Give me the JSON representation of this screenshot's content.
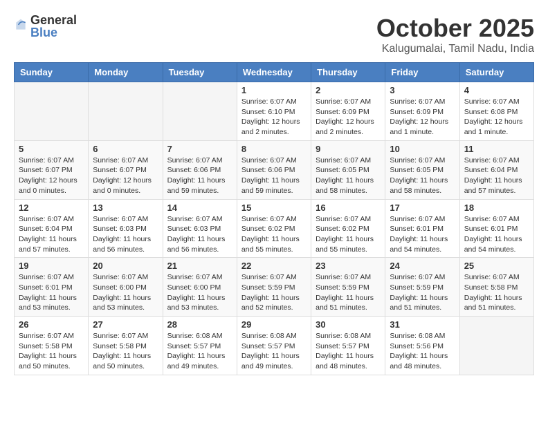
{
  "header": {
    "logo_general": "General",
    "logo_blue": "Blue",
    "month_title": "October 2025",
    "location": "Kalugumalai, Tamil Nadu, India"
  },
  "weekdays": [
    "Sunday",
    "Monday",
    "Tuesday",
    "Wednesday",
    "Thursday",
    "Friday",
    "Saturday"
  ],
  "weeks": [
    [
      {
        "day": "",
        "info": ""
      },
      {
        "day": "",
        "info": ""
      },
      {
        "day": "",
        "info": ""
      },
      {
        "day": "1",
        "info": "Sunrise: 6:07 AM\nSunset: 6:10 PM\nDaylight: 12 hours\nand 2 minutes."
      },
      {
        "day": "2",
        "info": "Sunrise: 6:07 AM\nSunset: 6:09 PM\nDaylight: 12 hours\nand 2 minutes."
      },
      {
        "day": "3",
        "info": "Sunrise: 6:07 AM\nSunset: 6:09 PM\nDaylight: 12 hours\nand 1 minute."
      },
      {
        "day": "4",
        "info": "Sunrise: 6:07 AM\nSunset: 6:08 PM\nDaylight: 12 hours\nand 1 minute."
      }
    ],
    [
      {
        "day": "5",
        "info": "Sunrise: 6:07 AM\nSunset: 6:07 PM\nDaylight: 12 hours\nand 0 minutes."
      },
      {
        "day": "6",
        "info": "Sunrise: 6:07 AM\nSunset: 6:07 PM\nDaylight: 12 hours\nand 0 minutes."
      },
      {
        "day": "7",
        "info": "Sunrise: 6:07 AM\nSunset: 6:06 PM\nDaylight: 11 hours\nand 59 minutes."
      },
      {
        "day": "8",
        "info": "Sunrise: 6:07 AM\nSunset: 6:06 PM\nDaylight: 11 hours\nand 59 minutes."
      },
      {
        "day": "9",
        "info": "Sunrise: 6:07 AM\nSunset: 6:05 PM\nDaylight: 11 hours\nand 58 minutes."
      },
      {
        "day": "10",
        "info": "Sunrise: 6:07 AM\nSunset: 6:05 PM\nDaylight: 11 hours\nand 58 minutes."
      },
      {
        "day": "11",
        "info": "Sunrise: 6:07 AM\nSunset: 6:04 PM\nDaylight: 11 hours\nand 57 minutes."
      }
    ],
    [
      {
        "day": "12",
        "info": "Sunrise: 6:07 AM\nSunset: 6:04 PM\nDaylight: 11 hours\nand 57 minutes."
      },
      {
        "day": "13",
        "info": "Sunrise: 6:07 AM\nSunset: 6:03 PM\nDaylight: 11 hours\nand 56 minutes."
      },
      {
        "day": "14",
        "info": "Sunrise: 6:07 AM\nSunset: 6:03 PM\nDaylight: 11 hours\nand 56 minutes."
      },
      {
        "day": "15",
        "info": "Sunrise: 6:07 AM\nSunset: 6:02 PM\nDaylight: 11 hours\nand 55 minutes."
      },
      {
        "day": "16",
        "info": "Sunrise: 6:07 AM\nSunset: 6:02 PM\nDaylight: 11 hours\nand 55 minutes."
      },
      {
        "day": "17",
        "info": "Sunrise: 6:07 AM\nSunset: 6:01 PM\nDaylight: 11 hours\nand 54 minutes."
      },
      {
        "day": "18",
        "info": "Sunrise: 6:07 AM\nSunset: 6:01 PM\nDaylight: 11 hours\nand 54 minutes."
      }
    ],
    [
      {
        "day": "19",
        "info": "Sunrise: 6:07 AM\nSunset: 6:01 PM\nDaylight: 11 hours\nand 53 minutes."
      },
      {
        "day": "20",
        "info": "Sunrise: 6:07 AM\nSunset: 6:00 PM\nDaylight: 11 hours\nand 53 minutes."
      },
      {
        "day": "21",
        "info": "Sunrise: 6:07 AM\nSunset: 6:00 PM\nDaylight: 11 hours\nand 53 minutes."
      },
      {
        "day": "22",
        "info": "Sunrise: 6:07 AM\nSunset: 5:59 PM\nDaylight: 11 hours\nand 52 minutes."
      },
      {
        "day": "23",
        "info": "Sunrise: 6:07 AM\nSunset: 5:59 PM\nDaylight: 11 hours\nand 51 minutes."
      },
      {
        "day": "24",
        "info": "Sunrise: 6:07 AM\nSunset: 5:59 PM\nDaylight: 11 hours\nand 51 minutes."
      },
      {
        "day": "25",
        "info": "Sunrise: 6:07 AM\nSunset: 5:58 PM\nDaylight: 11 hours\nand 51 minutes."
      }
    ],
    [
      {
        "day": "26",
        "info": "Sunrise: 6:07 AM\nSunset: 5:58 PM\nDaylight: 11 hours\nand 50 minutes."
      },
      {
        "day": "27",
        "info": "Sunrise: 6:07 AM\nSunset: 5:58 PM\nDaylight: 11 hours\nand 50 minutes."
      },
      {
        "day": "28",
        "info": "Sunrise: 6:08 AM\nSunset: 5:57 PM\nDaylight: 11 hours\nand 49 minutes."
      },
      {
        "day": "29",
        "info": "Sunrise: 6:08 AM\nSunset: 5:57 PM\nDaylight: 11 hours\nand 49 minutes."
      },
      {
        "day": "30",
        "info": "Sunrise: 6:08 AM\nSunset: 5:57 PM\nDaylight: 11 hours\nand 48 minutes."
      },
      {
        "day": "31",
        "info": "Sunrise: 6:08 AM\nSunset: 5:56 PM\nDaylight: 11 hours\nand 48 minutes."
      },
      {
        "day": "",
        "info": ""
      }
    ]
  ]
}
